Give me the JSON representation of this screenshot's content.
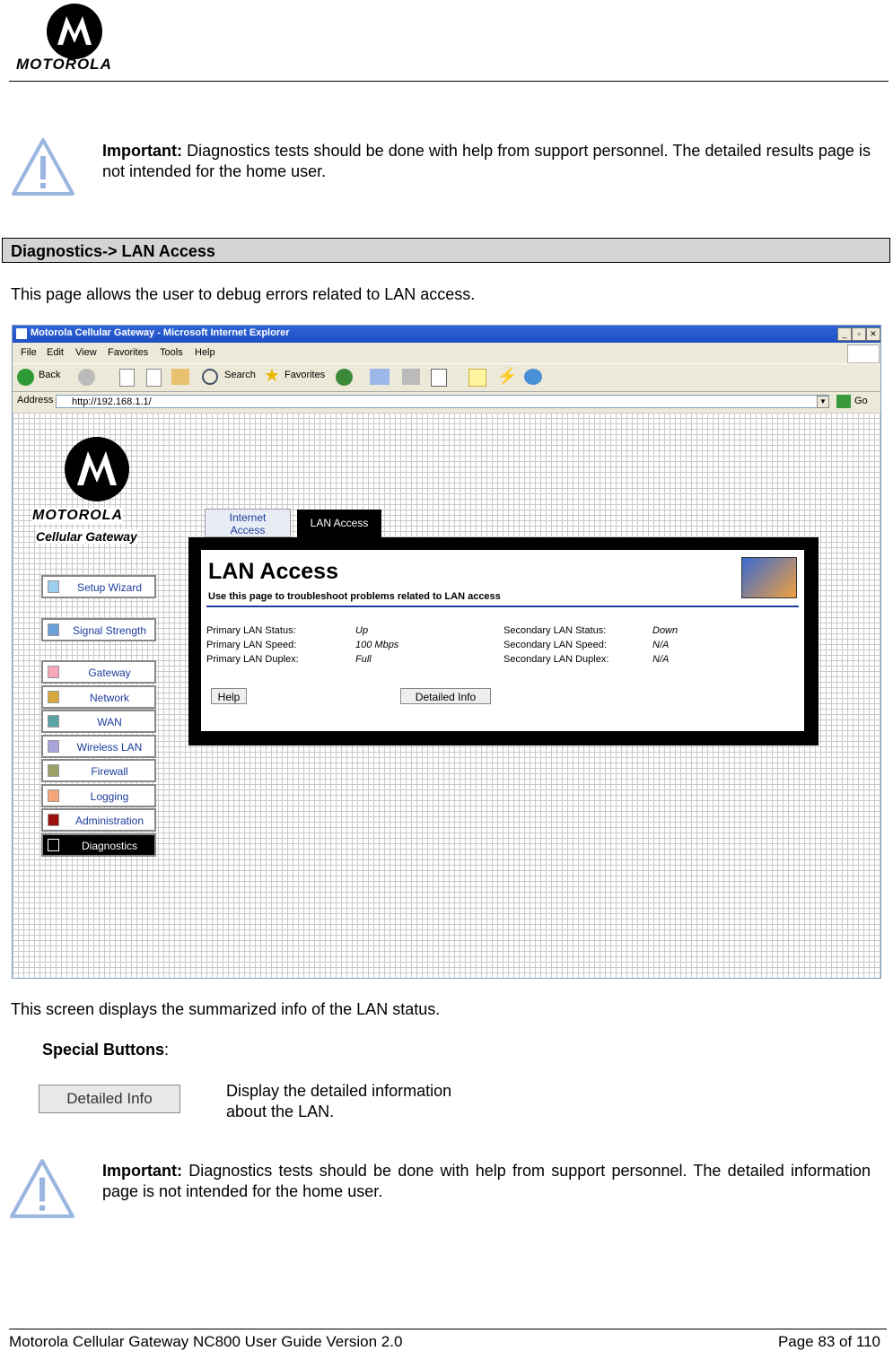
{
  "header": {
    "logo_text": "MOTOROLA"
  },
  "important_1": {
    "label": "Important:",
    "text": " Diagnostics tests should be done with help from support personnel.  The detailed results page is not intended for the home user."
  },
  "section": {
    "title": "Diagnostics-> LAN Access"
  },
  "intro": "This page allows the user to debug errors related to LAN access.",
  "browser": {
    "title": "Motorola Cellular Gateway - Microsoft Internet Explorer",
    "menu": [
      "File",
      "Edit",
      "View",
      "Favorites",
      "Tools",
      "Help"
    ],
    "toolbar": {
      "back": "Back",
      "search": "Search",
      "favorites": "Favorites"
    },
    "address_label": "Address",
    "address_value": "http://192.168.1.1/",
    "go": "Go"
  },
  "app": {
    "brand": "MOTOROLA",
    "product": "Cellular Gateway",
    "tabs": {
      "internet": "Internet Access",
      "lan": "LAN Access"
    },
    "nav": [
      {
        "label": "Setup Wizard",
        "color": "#9ccff0"
      },
      {
        "label": "Signal Strength",
        "color": "#6b9fd8"
      },
      {
        "label": "Gateway",
        "color": "#f7a8b8"
      },
      {
        "label": "Network",
        "color": "#d7a93c"
      },
      {
        "label": "WAN",
        "color": "#5aa3a3"
      },
      {
        "label": "Wireless LAN",
        "color": "#a8a3d8"
      },
      {
        "label": "Firewall",
        "color": "#9ea06a"
      },
      {
        "label": "Logging",
        "color": "#f7a67a"
      },
      {
        "label": "Administration",
        "color": "#9c1010"
      },
      {
        "label": "Diagnostics",
        "color": "#000000"
      }
    ],
    "panel": {
      "title": "LAN Access",
      "subtitle": "Use this page to troubleshoot problems related to LAN access",
      "primary": [
        {
          "label": "Primary LAN Status:",
          "value": "Up"
        },
        {
          "label": "Primary LAN Speed:",
          "value": "100 Mbps"
        },
        {
          "label": "Primary LAN Duplex:",
          "value": "Full"
        }
      ],
      "secondary": [
        {
          "label": "Secondary LAN Status:",
          "value": "Down"
        },
        {
          "label": "Secondary LAN Speed:",
          "value": "N/A"
        },
        {
          "label": "Secondary LAN Duplex:",
          "value": "N/A"
        }
      ],
      "help_button": "Help",
      "detailed_button": "Detailed Info"
    }
  },
  "summary": "This screen displays the summarized info of the LAN status.",
  "special": {
    "heading": "Special Buttons",
    "button_label": "Detailed Info",
    "description_line1": "Display the detailed information",
    "description_line2": "about the LAN."
  },
  "important_2": {
    "label": "Important:",
    "text": " Diagnostics tests should be done with help from support personnel.  The detailed information page is not intended for the home user."
  },
  "footer": {
    "left": "Motorola Cellular Gateway NC800 User Guide Version 2.0",
    "right": "Page 83 of 110"
  }
}
